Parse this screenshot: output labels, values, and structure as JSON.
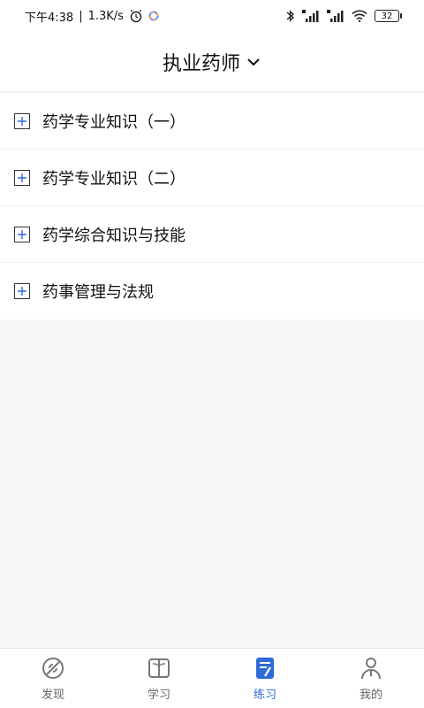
{
  "status_bar": {
    "time": "下午4:38",
    "separator": "|",
    "speed": "1.3K/s",
    "battery": "32"
  },
  "header": {
    "title": "执业药师"
  },
  "list": {
    "items": [
      {
        "label": "药学专业知识（一）"
      },
      {
        "label": "药学专业知识（二）"
      },
      {
        "label": "药学综合知识与技能"
      },
      {
        "label": "药事管理与法规"
      }
    ]
  },
  "tabbar": {
    "active": 2,
    "tabs": [
      {
        "label": "发现",
        "icon": "discover-icon"
      },
      {
        "label": "学习",
        "icon": "book-icon"
      },
      {
        "label": "练习",
        "icon": "practice-icon"
      },
      {
        "label": "我的",
        "icon": "profile-icon"
      }
    ]
  },
  "colors": {
    "accent": "#2f6bd8",
    "text": "#111111",
    "background": "#f7f7f7"
  }
}
